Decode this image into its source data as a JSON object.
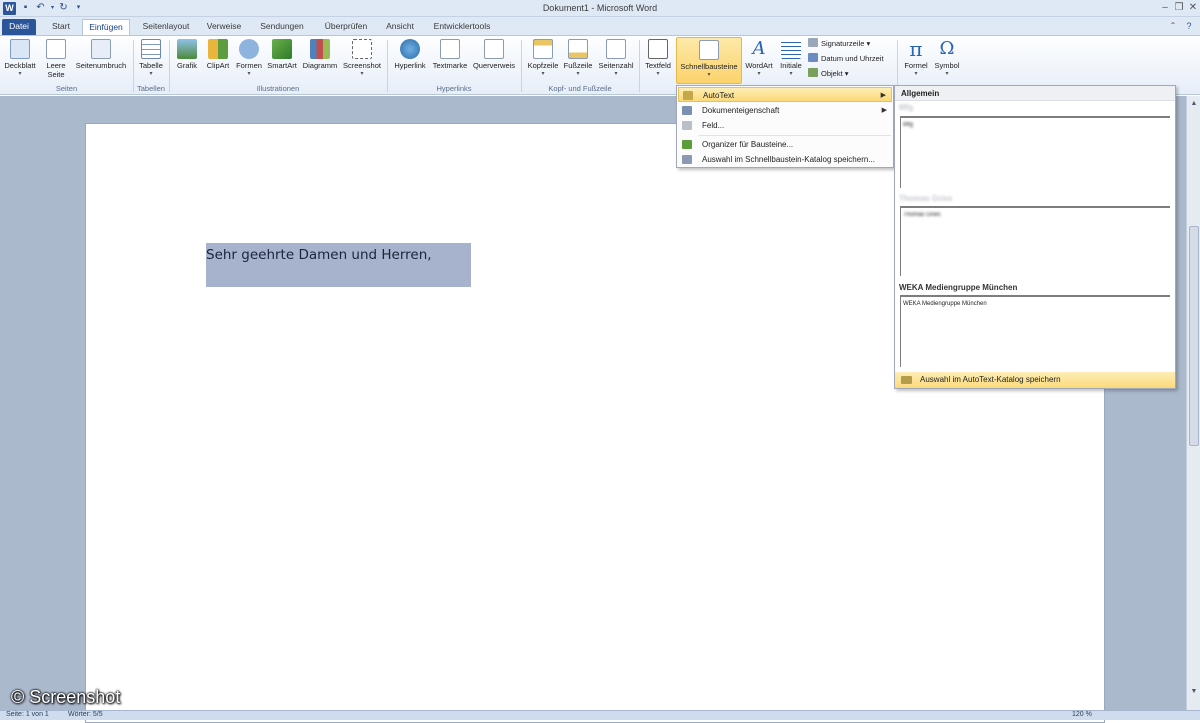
{
  "window": {
    "title": "Dokument1 - Microsoft Word",
    "app_letter": "W"
  },
  "tabs": [
    "Datei",
    "Start",
    "Einfügen",
    "Seitenlayout",
    "Verweise",
    "Sendungen",
    "Überprüfen",
    "Ansicht",
    "Entwicklertools"
  ],
  "ribbon": {
    "groups": {
      "seiten": {
        "label": "Seiten",
        "buttons": [
          "Deckblatt",
          "Leere Seite",
          "Seitenumbruch"
        ]
      },
      "tabellen": {
        "label": "Tabellen",
        "buttons": [
          "Tabelle"
        ]
      },
      "illustrationen": {
        "label": "Illustrationen",
        "buttons": [
          "Grafik",
          "ClipArt",
          "Formen",
          "SmartArt",
          "Diagramm",
          "Screenshot"
        ]
      },
      "hyperlinks": {
        "label": "Hyperlinks",
        "buttons": [
          "Hyperlink",
          "Textmarke",
          "Querverweis"
        ]
      },
      "kopf": {
        "label": "Kopf- und Fußzeile",
        "buttons": [
          "Kopfzeile",
          "Fußzeile",
          "Seitenzahl"
        ]
      },
      "text": {
        "buttons": [
          "Textfeld",
          "Schnellbausteine",
          "WordArt",
          "Initiale"
        ],
        "small": [
          "Signaturzeile",
          "Datum und Uhrzeit",
          "Objekt"
        ]
      },
      "symbole": {
        "buttons": [
          "Formel",
          "Symbol"
        ],
        "icons": [
          "π",
          "Ω"
        ]
      }
    }
  },
  "menu": {
    "items": [
      "AutoText",
      "Dokumenteigenschaft",
      "Feld...",
      "Organizer für Bausteine...",
      "Auswahl im Schnellbaustein-Katalog speichern..."
    ]
  },
  "autotext_panel": {
    "header": "Allgemein",
    "entries": [
      {
        "title": "Mfg",
        "preview": "Mfg"
      },
      {
        "title": "Thomas Gries",
        "preview": "Thomas Gries"
      },
      {
        "title": "WEKA Mediengruppe München",
        "preview": "WEKA Mediengruppe München"
      }
    ],
    "save_label": "Auswahl im AutoText-Katalog speichern"
  },
  "document": {
    "text": "Sehr geehrte Damen und Herren,"
  },
  "statusbar": {
    "page": "Seite: 1 von 1",
    "words": "Wörter: 5/5",
    "zoom": "120 %"
  },
  "watermark": "© Screenshot",
  "colors": {
    "file_tab": "#2a5699",
    "highlight": "#fbd97a",
    "selection": "#a7b3cd"
  }
}
